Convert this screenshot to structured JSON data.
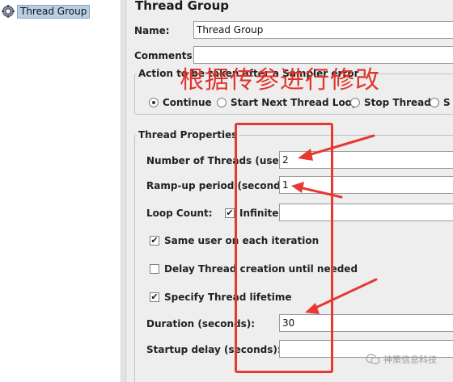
{
  "tree": {
    "selected_label": "Thread Group"
  },
  "panel": {
    "title": "Thread Group",
    "name_label": "Name:",
    "name_value": "Thread Group",
    "comments_label": "Comments:",
    "comments_value": "",
    "error_group": {
      "legend": "Action to be taken after a Sampler error",
      "options": [
        {
          "label": "Continue",
          "selected": true
        },
        {
          "label": "Start Next Thread Loop",
          "selected": false
        },
        {
          "label": "Stop Thread",
          "selected": false
        },
        {
          "label": "S",
          "selected": false
        }
      ]
    },
    "thread_props": {
      "legend": "Thread Properties",
      "num_threads_label": "Number of Threads (users):",
      "num_threads_value": "2",
      "rampup_label": "Ramp-up period (seconds):",
      "rampup_value": "1",
      "loop_count_label": "Loop Count:",
      "infinite_label": "Infinite",
      "infinite_checked": true,
      "loop_count_value": "",
      "same_user_label": "Same user on each iteration",
      "same_user_checked": true,
      "delay_label": "Delay Thread creation until needed",
      "delay_checked": false,
      "lifetime_label": "Specify Thread lifetime",
      "lifetime_checked": true,
      "duration_label": "Duration (seconds):",
      "duration_value": "30",
      "startup_label": "Startup delay (seconds):",
      "startup_value": ""
    }
  },
  "annotation": {
    "text": "根据传参进行修改",
    "color": "#e0342b"
  },
  "watermark": {
    "text": "神策信息科技"
  },
  "colors": {
    "annotation_red": "#e53a31",
    "selection_blue": "#b9cfe6",
    "panel_bg": "#eeeeee"
  }
}
